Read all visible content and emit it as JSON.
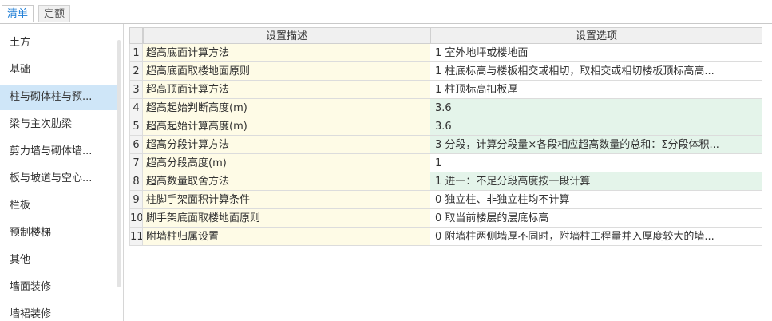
{
  "tabs": [
    {
      "label": "清单",
      "active": true
    },
    {
      "label": "定额",
      "active": false
    }
  ],
  "sidebar": {
    "selected_index": 2,
    "items": [
      {
        "label": "土方"
      },
      {
        "label": "基础"
      },
      {
        "label": "柱与砌体柱与预..."
      },
      {
        "label": "梁与主次肋梁"
      },
      {
        "label": "剪力墙与砌体墙..."
      },
      {
        "label": "板与坡道与空心..."
      },
      {
        "label": "栏板"
      },
      {
        "label": "预制楼梯"
      },
      {
        "label": "其他"
      },
      {
        "label": "墙面装修"
      },
      {
        "label": "墙裙装修"
      }
    ]
  },
  "table": {
    "headers": {
      "description": "设置描述",
      "option": "设置选项"
    },
    "rows": [
      {
        "num": "1",
        "description": "超高底面计算方法",
        "option": "1 室外地坪或楼地面",
        "highlight": false
      },
      {
        "num": "2",
        "description": "超高底面取楼地面原则",
        "option": "1 柱底标高与楼板相交或相切，取相交或相切楼板顶标高高...",
        "highlight": false
      },
      {
        "num": "3",
        "description": "超高顶面计算方法",
        "option": "1 柱顶标高扣板厚",
        "highlight": false
      },
      {
        "num": "4",
        "description": "超高起始判断高度(m)",
        "option": "3.6",
        "highlight": true
      },
      {
        "num": "5",
        "description": "超高起始计算高度(m)",
        "option": "3.6",
        "highlight": true
      },
      {
        "num": "6",
        "description": "超高分段计算方法",
        "option": "3 分段，计算分段量×各段相应超高数量的总和：Σ分段体积...",
        "highlight": true
      },
      {
        "num": "7",
        "description": "超高分段高度(m)",
        "option": "1",
        "highlight": false
      },
      {
        "num": "8",
        "description": "超高数量取舍方法",
        "option": "1 进一：不足分段高度按一段计算",
        "highlight": true
      },
      {
        "num": "9",
        "description": "柱脚手架面积计算条件",
        "option": "0 独立柱、非独立柱均不计算",
        "highlight": false
      },
      {
        "num": "10",
        "description": "脚手架底面取楼地面原则",
        "option": "0 取当前楼层的层底标高",
        "highlight": false
      },
      {
        "num": "11",
        "description": "附墙柱归属设置",
        "option": "0 附墙柱两侧墙厚不同时，附墙柱工程量并入厚度较大的墙...",
        "highlight": false
      }
    ]
  }
}
